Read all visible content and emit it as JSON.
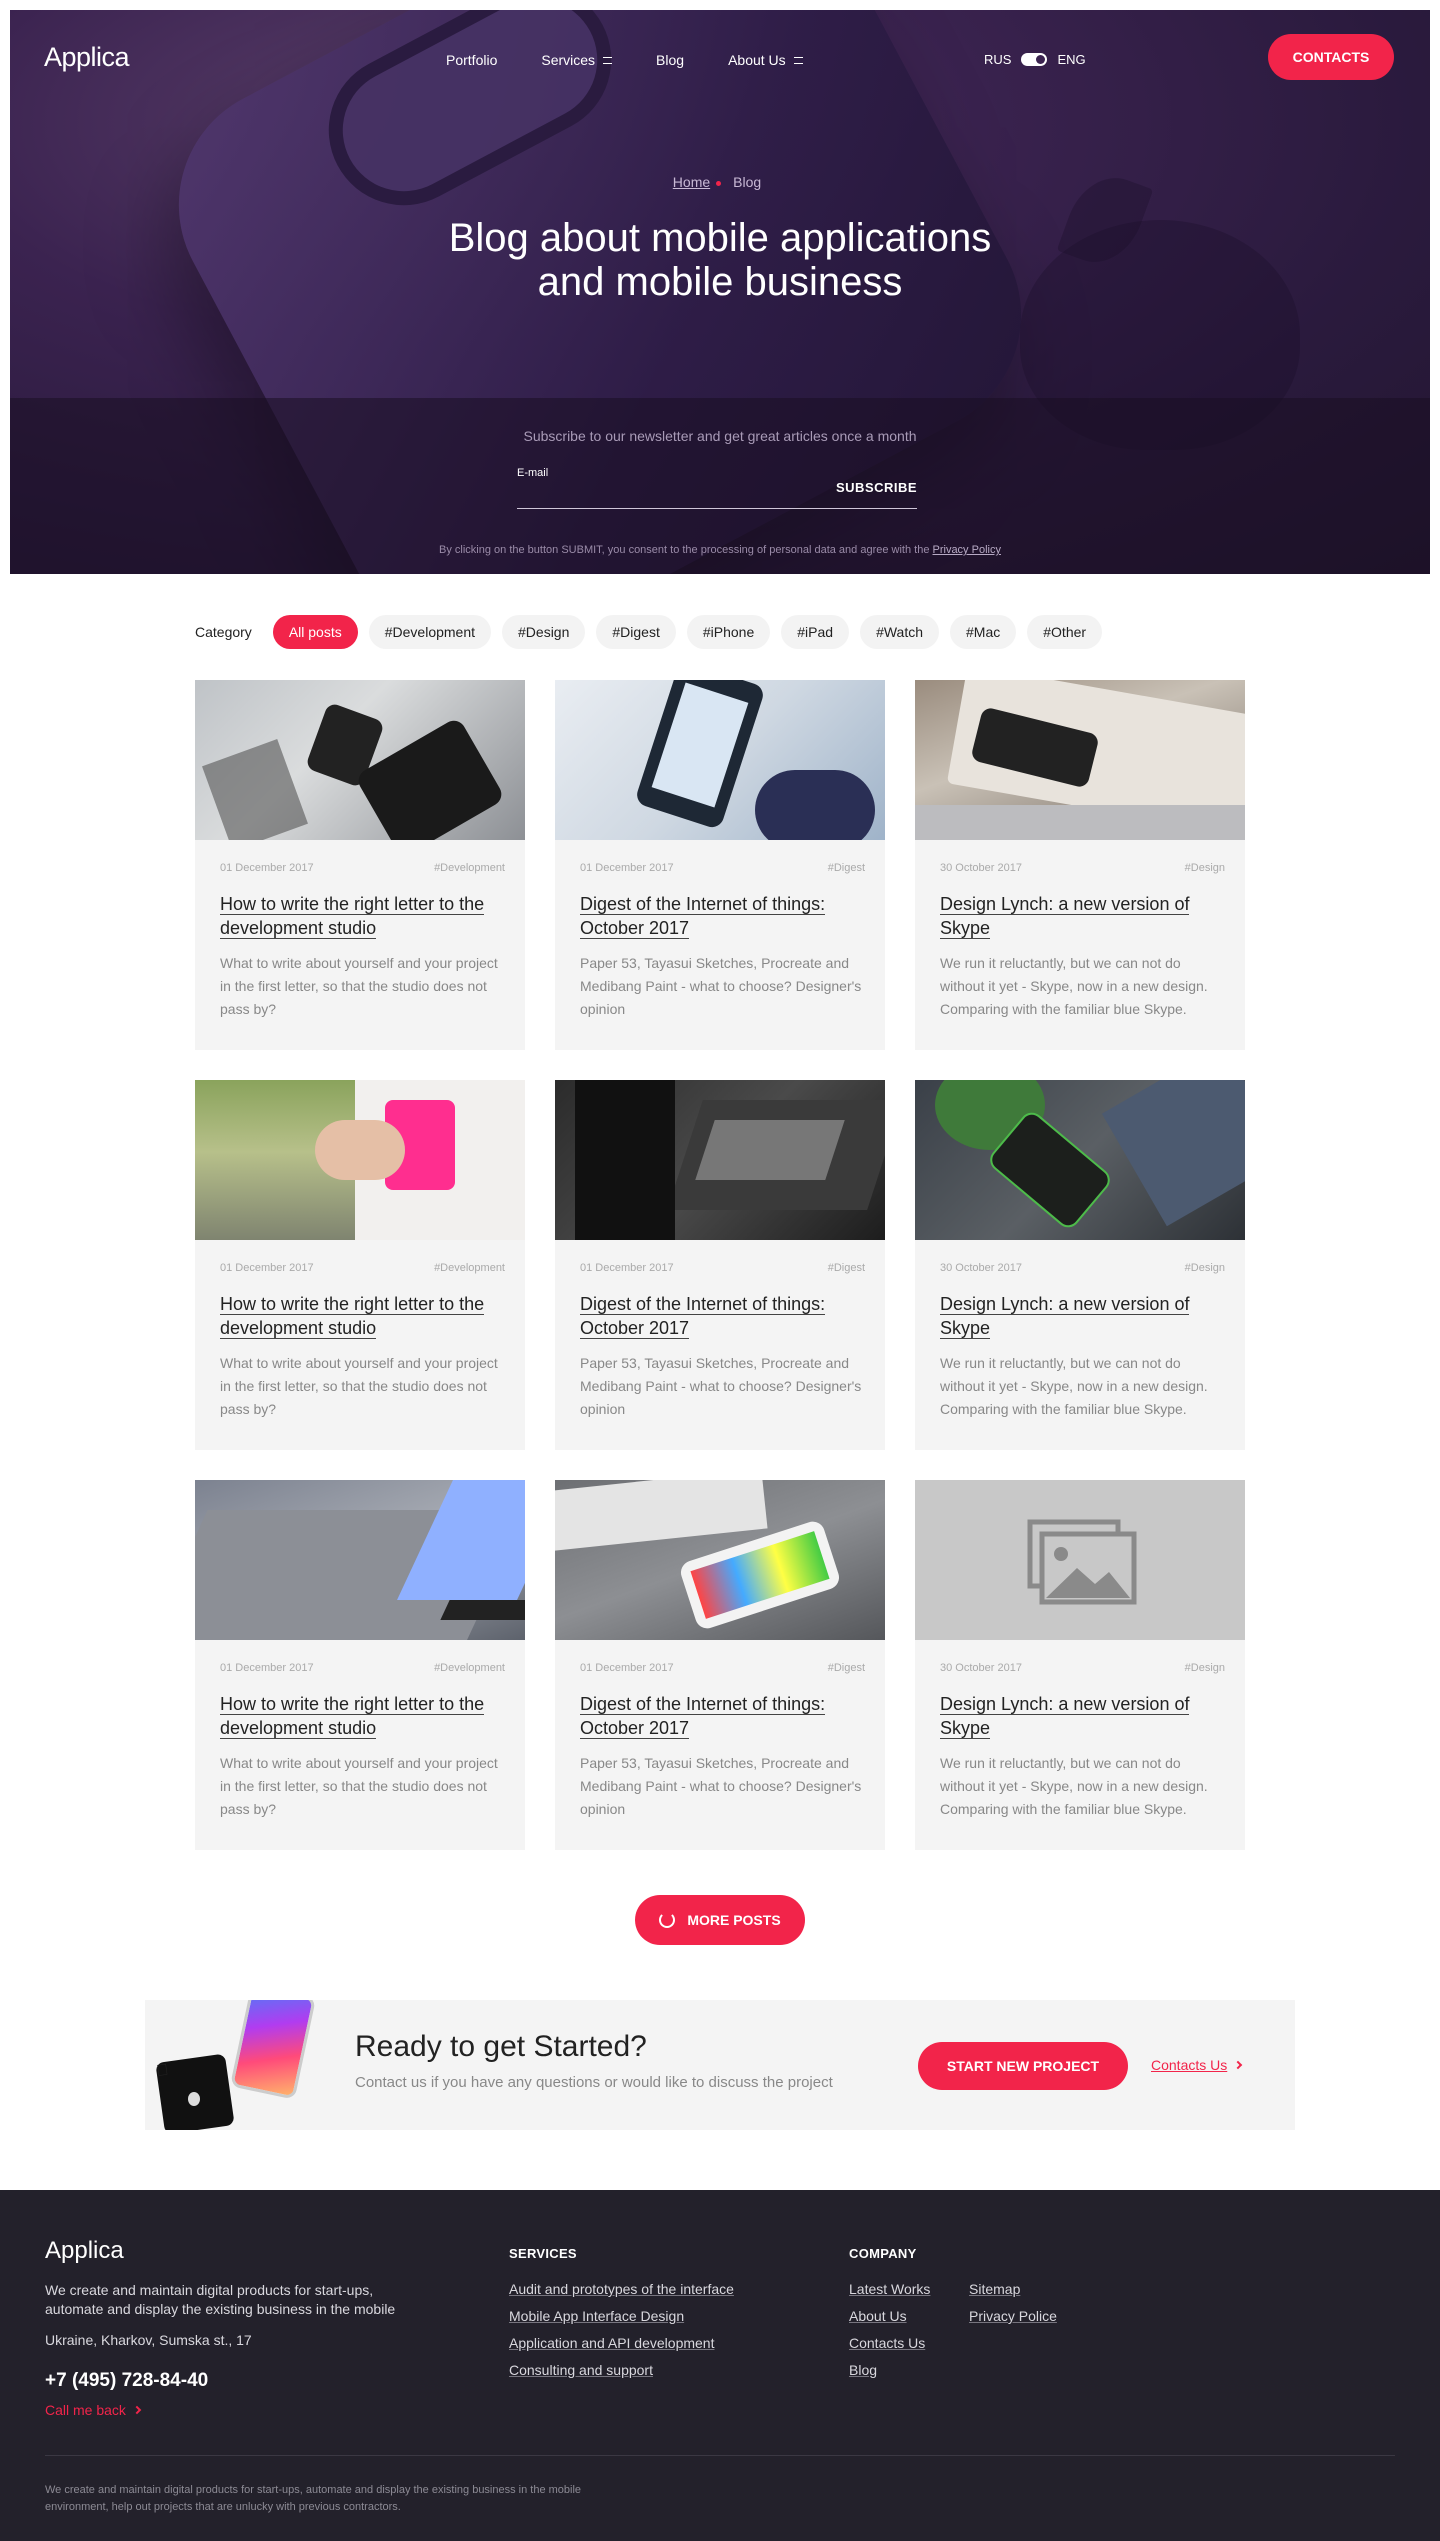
{
  "header": {
    "logo": "Applica",
    "nav": [
      {
        "label": "Portfolio",
        "menu": false
      },
      {
        "label": "Services",
        "menu": true
      },
      {
        "label": "Blog",
        "menu": false
      },
      {
        "label": "About Us",
        "menu": true
      }
    ],
    "lang_left": "RUS",
    "lang_right": "ENG",
    "contacts_label": "CONTACTS"
  },
  "hero": {
    "breadcrumb_home": "Home",
    "breadcrumb_current": "Blog",
    "title_line1": "Blog about mobile applications",
    "title_line2": "and mobile business",
    "subscribe_text": "Subscribe to our newsletter and get great articles once a month",
    "email_label": "E-mail",
    "subscribe_button": "SUBSCRIBE",
    "consent_text": "By clicking on the button SUBMIT, you consent to the processing of personal data and agree with the",
    "consent_link": "Privacy Policy"
  },
  "categories": {
    "label": "Category",
    "items": [
      "All posts",
      "#Development",
      "#Design",
      "#Digest",
      "#iPhone",
      "#iPad",
      "#Watch",
      "#Mac",
      "#Other"
    ],
    "active": "All posts"
  },
  "posts": [
    {
      "date": "01 December 2017",
      "tag": "#Development",
      "title": "How to write the right letter to the development studio",
      "desc": "What to write about yourself and your project in the first letter, so that the studio does not pass by?"
    },
    {
      "date": "01 December 2017",
      "tag": "#Digest",
      "title": "Digest of the Internet of things: October 2017",
      "desc": "Paper 53, Tayasui Sketches, Procreate and Medibang Paint - what to choose? Designer's opinion"
    },
    {
      "date": "30 October 2017",
      "tag": "#Design",
      "title": "Design Lynch: a new version of Skype",
      "desc": "We run it reluctantly, but we can not do without it yet - Skype, now in a new design. Comparing with the familiar blue Skype."
    },
    {
      "date": "01 December 2017",
      "tag": "#Development",
      "title": "How to write the right letter to the development studio",
      "desc": "What to write about yourself and your project in the first letter, so that the studio does not pass by?"
    },
    {
      "date": "01 December 2017",
      "tag": "#Digest",
      "title": "Digest of the Internet of things: October 2017",
      "desc": "Paper 53, Tayasui Sketches, Procreate and Medibang Paint - what to choose? Designer's opinion"
    },
    {
      "date": "30 October 2017",
      "tag": "#Design",
      "title": "Design Lynch: a new version of Skype",
      "desc": "We run it reluctantly, but we can not do without it yet - Skype, now in a new design. Comparing with the familiar blue Skype."
    },
    {
      "date": "01 December 2017",
      "tag": "#Development",
      "title": "How to write the right letter to the development studio",
      "desc": "What to write about yourself and your project in the first letter, so that the studio does not pass by?"
    },
    {
      "date": "01 December 2017",
      "tag": "#Digest",
      "title": "Digest of the Internet of things: October 2017",
      "desc": "Paper 53, Tayasui Sketches, Procreate and Medibang Paint - what to choose? Designer's opinion"
    },
    {
      "date": "30 October 2017",
      "tag": "#Design",
      "title": "Design Lynch: a new version of Skype",
      "desc": "We run it reluctantly, but we can not do without it yet - Skype, now in a new design. Comparing with the familiar blue Skype."
    }
  ],
  "more_posts_label": "MORE POSTS",
  "cta": {
    "title": "Ready to get Started?",
    "text": "Contact us if you have any questions or would like to discuss the project",
    "button": "START NEW PROJECT",
    "link": "Contacts Us"
  },
  "footer": {
    "logo": "Applica",
    "desc": "We create and maintain digital products for start-ups, automate and display the existing business in the mobile",
    "address": "Ukraine, Kharkov, Sumska st., 17",
    "phone": "+7 (495) 728-84-40",
    "call_back": "Call me back",
    "services_title": "SERVICES",
    "services": [
      "Audit and prototypes of the interface",
      "Mobile App Interface Design",
      "Application and API development",
      "Consulting and support"
    ],
    "company_title": "COMPANY",
    "company_col1": [
      "Latest Works",
      "About Us",
      "Contacts Us",
      "Blog"
    ],
    "company_col2": [
      "Sitemap",
      "Privacy Police"
    ],
    "bottom_text": "We create and maintain digital products for start-ups, automate and display the existing business in the mobile environment, help out projects that are unlucky with previous contractors."
  },
  "colors": {
    "accent": "#f2244a",
    "hero_bg": "#2a1a3d",
    "footer_bg": "#23212b",
    "card_bg": "#f4f4f4"
  }
}
